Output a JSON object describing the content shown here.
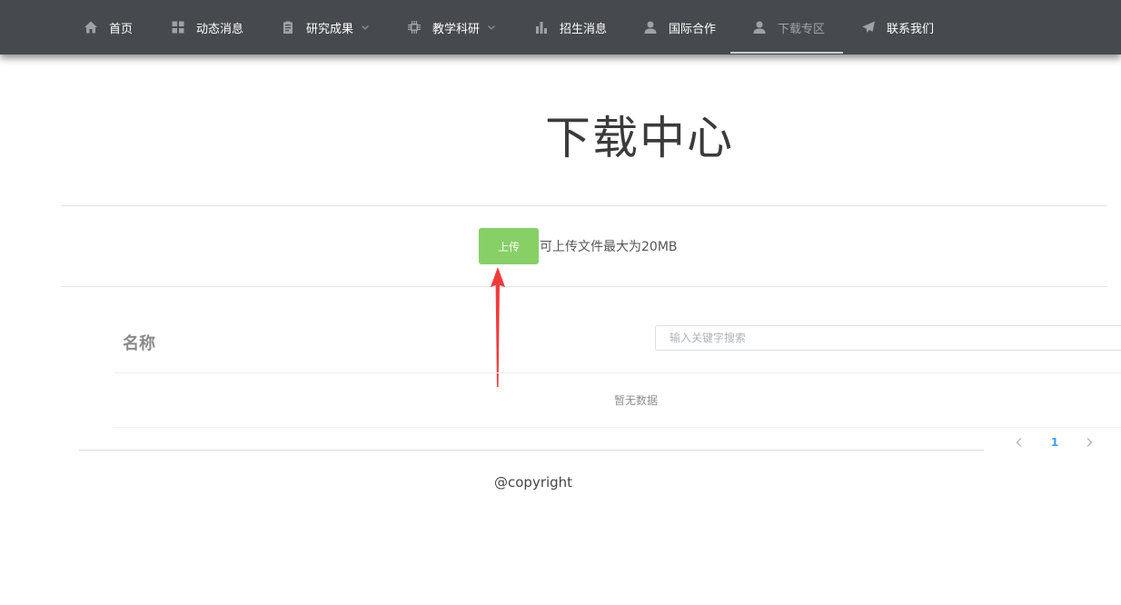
{
  "nav": {
    "items": [
      {
        "label": "首页",
        "icon": "home-icon"
      },
      {
        "label": "动态消息",
        "icon": "grid-icon"
      },
      {
        "label": "研究成果",
        "icon": "clipboard-icon",
        "dropdown": true
      },
      {
        "label": "教学科研",
        "icon": "chip-icon",
        "dropdown": true
      },
      {
        "label": "招生消息",
        "icon": "bar-chart-icon"
      },
      {
        "label": "国际合作",
        "icon": "user-icon"
      },
      {
        "label": "下载专区",
        "icon": "user-icon",
        "active": true
      },
      {
        "label": "联系我们",
        "icon": "send-icon"
      }
    ]
  },
  "page": {
    "title": "下载中心"
  },
  "upload": {
    "button_label": "上传",
    "hint": "可上传文件最大为20MB"
  },
  "table": {
    "column_name": "名称",
    "search_placeholder": "输入关键字搜索",
    "empty_text": "暂无数据"
  },
  "pagination": {
    "current_page": "1"
  },
  "footer": {
    "copyright": "@copyright"
  },
  "colors": {
    "navbar": "#464a4e",
    "upload_button": "#86d065",
    "annotation_arrow": "#f23a3a",
    "page_link": "#409eff"
  }
}
